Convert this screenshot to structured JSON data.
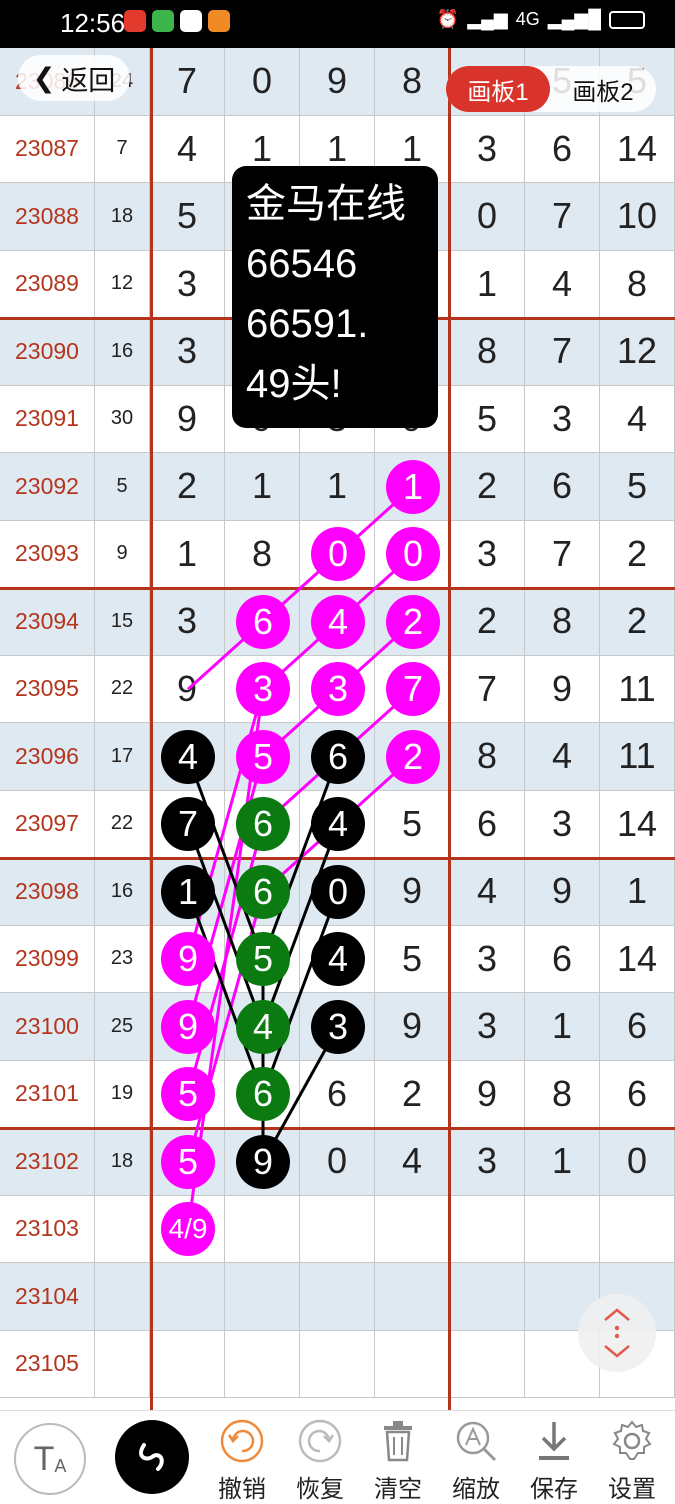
{
  "status_bar": {
    "time": "12:56",
    "network": "4G",
    "app_icon_colors": [
      "#e23a2c",
      "#3bb54a",
      "#ffffff",
      "#f08a24"
    ]
  },
  "nav": {
    "back_label": "返回",
    "tabs": [
      {
        "label": "画板1",
        "active": true
      },
      {
        "label": "画板2",
        "active": false
      }
    ]
  },
  "toast": {
    "lines": [
      "金马在线",
      "66546",
      "66591.",
      "49头!"
    ]
  },
  "table": {
    "rows": [
      {
        "issue": "23086",
        "sum": "24",
        "digits": [
          "7",
          "0",
          "9",
          "8"
        ],
        "right": [
          "",
          "5",
          "5"
        ]
      },
      {
        "issue": "23087",
        "sum": "7",
        "digits": [
          "4",
          "1",
          "1",
          "1"
        ],
        "right": [
          "3",
          "6",
          "14"
        ]
      },
      {
        "issue": "23088",
        "sum": "18",
        "digits": [
          "5",
          "",
          "",
          ""
        ],
        "right": [
          "0",
          "7",
          "10"
        ]
      },
      {
        "issue": "23089",
        "sum": "12",
        "digits": [
          "3",
          "",
          "",
          ""
        ],
        "right": [
          "1",
          "4",
          "8"
        ]
      },
      {
        "issue": "23090",
        "sum": "16",
        "digits": [
          "3",
          "",
          "",
          ""
        ],
        "right": [
          "8",
          "7",
          "12"
        ]
      },
      {
        "issue": "23091",
        "sum": "30",
        "digits": [
          "9",
          "9",
          "3",
          "9"
        ],
        "right": [
          "5",
          "3",
          "4"
        ]
      },
      {
        "issue": "23092",
        "sum": "5",
        "digits": [
          "2",
          "1",
          "1",
          ""
        ],
        "right": [
          "2",
          "6",
          "5"
        ]
      },
      {
        "issue": "23093",
        "sum": "9",
        "digits": [
          "1",
          "8",
          "",
          ""
        ],
        "right": [
          "3",
          "7",
          "2"
        ]
      },
      {
        "issue": "23094",
        "sum": "15",
        "digits": [
          "3",
          "",
          "",
          ""
        ],
        "right": [
          "2",
          "8",
          "2"
        ]
      },
      {
        "issue": "23095",
        "sum": "22",
        "digits": [
          "9",
          "",
          "",
          ""
        ],
        "right": [
          "7",
          "9",
          "11"
        ]
      },
      {
        "issue": "23096",
        "sum": "17",
        "digits": [
          "",
          "",
          "",
          ""
        ],
        "right": [
          "8",
          "4",
          "11"
        ]
      },
      {
        "issue": "23097",
        "sum": "22",
        "digits": [
          "",
          "",
          "",
          "5"
        ],
        "right": [
          "6",
          "3",
          "14"
        ]
      },
      {
        "issue": "23098",
        "sum": "16",
        "digits": [
          "",
          "",
          "",
          "9"
        ],
        "right": [
          "4",
          "9",
          "1"
        ]
      },
      {
        "issue": "23099",
        "sum": "23",
        "digits": [
          "",
          "",
          "",
          "5"
        ],
        "right": [
          "3",
          "6",
          "14"
        ]
      },
      {
        "issue": "23100",
        "sum": "25",
        "digits": [
          "",
          "",
          "",
          "9"
        ],
        "right": [
          "3",
          "1",
          "6"
        ]
      },
      {
        "issue": "23101",
        "sum": "19",
        "digits": [
          "",
          "",
          "6",
          "2"
        ],
        "right": [
          "9",
          "8",
          "6"
        ]
      },
      {
        "issue": "23102",
        "sum": "18",
        "digits": [
          "",
          "",
          "0",
          "4"
        ],
        "right": [
          "3",
          "1",
          "0"
        ]
      },
      {
        "issue": "23103",
        "sum": "",
        "digits": [
          "",
          "",
          "",
          ""
        ],
        "right": [
          "",
          "",
          ""
        ]
      },
      {
        "issue": "23104",
        "sum": "",
        "digits": [
          "",
          "",
          "",
          ""
        ],
        "right": [
          "",
          "",
          ""
        ]
      },
      {
        "issue": "23105",
        "sum": "",
        "digits": [
          "",
          "",
          "",
          ""
        ],
        "right": [
          "",
          "",
          ""
        ]
      }
    ]
  },
  "balls": [
    {
      "row": 6,
      "col": 3,
      "text": "1",
      "color": "m"
    },
    {
      "row": 7,
      "col": 2,
      "text": "0",
      "color": "m"
    },
    {
      "row": 7,
      "col": 3,
      "text": "0",
      "color": "m"
    },
    {
      "row": 8,
      "col": 1,
      "text": "6",
      "color": "m"
    },
    {
      "row": 8,
      "col": 2,
      "text": "4",
      "color": "m"
    },
    {
      "row": 8,
      "col": 3,
      "text": "2",
      "color": "m"
    },
    {
      "row": 9,
      "col": 1,
      "text": "3",
      "color": "m"
    },
    {
      "row": 9,
      "col": 2,
      "text": "3",
      "color": "m"
    },
    {
      "row": 9,
      "col": 3,
      "text": "7",
      "color": "m"
    },
    {
      "row": 10,
      "col": 0,
      "text": "4",
      "color": "k"
    },
    {
      "row": 10,
      "col": 1,
      "text": "5",
      "color": "m"
    },
    {
      "row": 10,
      "col": 2,
      "text": "6",
      "color": "k"
    },
    {
      "row": 10,
      "col": 3,
      "text": "2",
      "color": "m"
    },
    {
      "row": 11,
      "col": 0,
      "text": "7",
      "color": "k"
    },
    {
      "row": 11,
      "col": 1,
      "text": "6",
      "color": "g"
    },
    {
      "row": 11,
      "col": 2,
      "text": "4",
      "color": "k"
    },
    {
      "row": 12,
      "col": 0,
      "text": "1",
      "color": "k"
    },
    {
      "row": 12,
      "col": 1,
      "text": "6",
      "color": "g"
    },
    {
      "row": 12,
      "col": 2,
      "text": "0",
      "color": "k"
    },
    {
      "row": 13,
      "col": 0,
      "text": "9",
      "color": "m"
    },
    {
      "row": 13,
      "col": 1,
      "text": "5",
      "color": "g"
    },
    {
      "row": 13,
      "col": 2,
      "text": "4",
      "color": "k"
    },
    {
      "row": 14,
      "col": 0,
      "text": "9",
      "color": "m"
    },
    {
      "row": 14,
      "col": 1,
      "text": "4",
      "color": "g"
    },
    {
      "row": 14,
      "col": 2,
      "text": "3",
      "color": "k"
    },
    {
      "row": 15,
      "col": 0,
      "text": "5",
      "color": "m"
    },
    {
      "row": 15,
      "col": 1,
      "text": "6",
      "color": "g"
    },
    {
      "row": 16,
      "col": 0,
      "text": "5",
      "color": "m"
    },
    {
      "row": 16,
      "col": 1,
      "text": "9",
      "color": "k"
    },
    {
      "row": 17,
      "col": 0,
      "text": "4/9",
      "color": "m"
    }
  ],
  "toolbar": {
    "items": [
      {
        "label": "撤销",
        "icon": "undo-icon"
      },
      {
        "label": "恢复",
        "icon": "redo-icon"
      },
      {
        "label": "清空",
        "icon": "trash-icon"
      },
      {
        "label": "缩放",
        "icon": "zoom-icon"
      },
      {
        "label": "保存",
        "icon": "download-icon"
      },
      {
        "label": "设置",
        "icon": "gear-icon"
      }
    ],
    "ta_label": "T",
    "ta_sub": "A"
  },
  "colors": {
    "grid_accent": "#b5351c",
    "row_alt": "#dfe9f2",
    "magenta": "#ff00ff",
    "green": "#0b7a10",
    "tab_active": "#d9342b"
  }
}
